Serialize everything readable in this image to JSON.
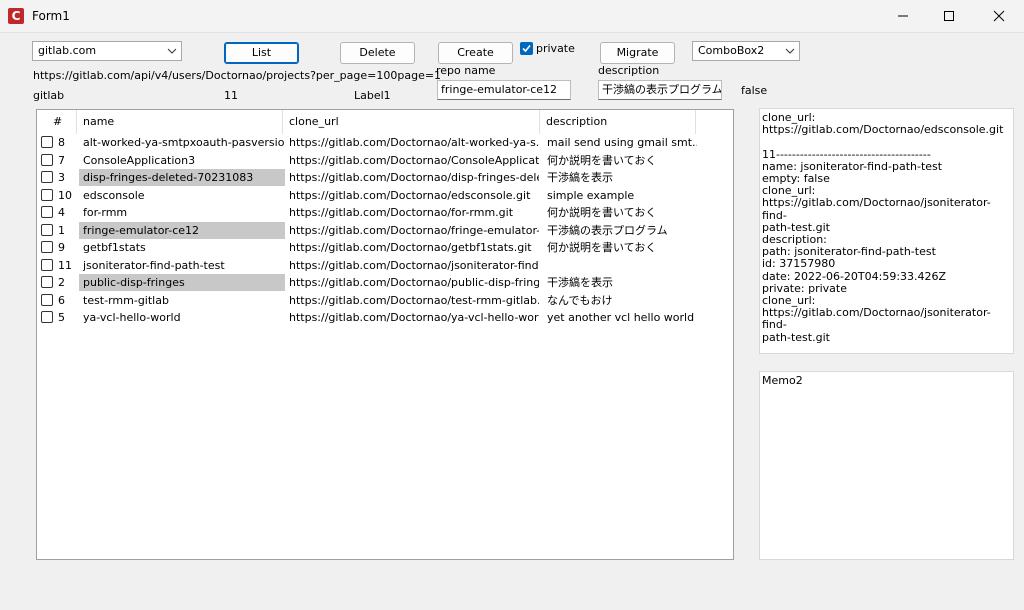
{
  "window": {
    "title": "Form1",
    "icon_letter": "C"
  },
  "toolbar": {
    "host_combo": "gitlab.com",
    "list_label": "List",
    "delete_label": "Delete",
    "create_label": "Create",
    "private_label": "private",
    "private_checked": true,
    "migrate_label": "Migrate",
    "combo2": "ComboBox2"
  },
  "labels": {
    "url": "https://gitlab.com/api/v4/users/Doctornao/projects?per_page=100page=1",
    "repo_name": "repo name",
    "description": "description",
    "host": "gitlab",
    "count": "11",
    "label1": "Label1",
    "flag": "false"
  },
  "inputs": {
    "repo_name": "fringe-emulator-ce12",
    "description": "干渉縞の表示プログラム"
  },
  "grid": {
    "columns": [
      "#",
      "name",
      "clone_url",
      "description"
    ],
    "rows": [
      {
        "id": "8",
        "name": "alt-worked-ya-smtpxoauth-pasversion",
        "url": "https://gitlab.com/Doctornao/alt-worked-ya-s...",
        "desc": "mail send using gmail smt...",
        "hl": false
      },
      {
        "id": "7",
        "name": "ConsoleApplication3",
        "url": "https://gitlab.com/Doctornao/ConsoleApplicati...",
        "desc": "何か説明を書いておく",
        "hl": false
      },
      {
        "id": "3",
        "name": "disp-fringes-deleted-70231083",
        "url": "https://gitlab.com/Doctornao/disp-fringes-dele...",
        "desc": "干渉縞を表示",
        "hl": true
      },
      {
        "id": "10",
        "name": "edsconsole",
        "url": "https://gitlab.com/Doctornao/edsconsole.git",
        "desc": "simple example",
        "hl": false
      },
      {
        "id": "4",
        "name": "for-rmm",
        "url": "https://gitlab.com/Doctornao/for-rmm.git",
        "desc": "何か説明を書いておく",
        "hl": false
      },
      {
        "id": "1",
        "name": "fringe-emulator-ce12",
        "url": "https://gitlab.com/Doctornao/fringe-emulator-...",
        "desc": "干渉縞の表示プログラム",
        "hl": true
      },
      {
        "id": "9",
        "name": "getbf1stats",
        "url": "https://gitlab.com/Doctornao/getbf1stats.git",
        "desc": "何か説明を書いておく",
        "hl": false
      },
      {
        "id": "11",
        "name": "jsoniterator-find-path-test",
        "url": "https://gitlab.com/Doctornao/jsoniterator-find...",
        "desc": "",
        "hl": false
      },
      {
        "id": "2",
        "name": "public-disp-fringes",
        "url": "https://gitlab.com/Doctornao/public-disp-fring...",
        "desc": "干渉縞を表示",
        "hl": true
      },
      {
        "id": "6",
        "name": "test-rmm-gitlab",
        "url": "https://gitlab.com/Doctornao/test-rmm-gitlab.git",
        "desc": "なんでもおけ",
        "hl": false
      },
      {
        "id": "5",
        "name": "ya-vcl-hello-world",
        "url": "https://gitlab.com/Doctornao/ya-vcl-hello-worl...",
        "desc": "yet another vcl hello world",
        "hl": false
      }
    ]
  },
  "memo1": "clone_url:\nhttps://gitlab.com/Doctornao/edsconsole.git\n\n11---------------------------------------\nname: jsoniterator-find-path-test\nempty: false\nclone_url:\nhttps://gitlab.com/Doctornao/jsoniterator-find-\npath-test.git\ndescription:\npath: jsoniterator-find-path-test\nid: 37157980\ndate: 2022-06-20T04:59:33.426Z\nprivate: private\nclone_url:\nhttps://gitlab.com/Doctornao/jsoniterator-find-\npath-test.git",
  "memo2": "Memo2"
}
